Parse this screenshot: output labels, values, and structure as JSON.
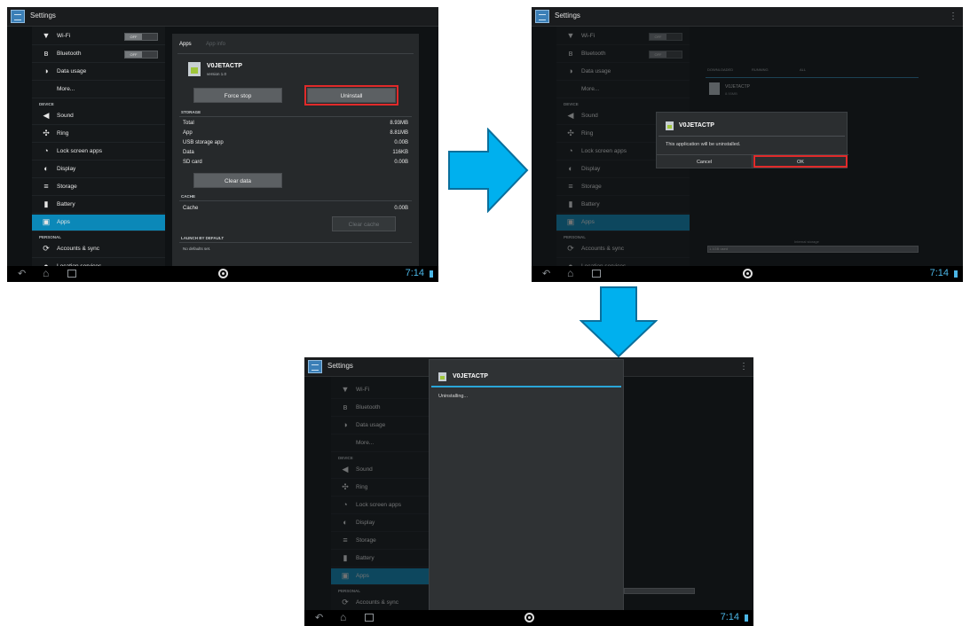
{
  "common": {
    "title": "Settings",
    "clock": "7:14",
    "sidebar": {
      "items": [
        {
          "icon": "▼",
          "label": "Wi-Fi",
          "toggle": "OFF"
        },
        {
          "icon": "ʙ",
          "label": "Bluetooth",
          "toggle": "OFF"
        },
        {
          "icon": "◑",
          "label": "Data usage"
        },
        {
          "icon": "",
          "label": "More..."
        },
        {
          "icon": "◀",
          "label": "Sound"
        },
        {
          "icon": "✣",
          "label": "Ring"
        },
        {
          "icon": "◔",
          "label": "Lock screen apps"
        },
        {
          "icon": "◐",
          "label": "Display"
        },
        {
          "icon": "≡",
          "label": "Storage"
        },
        {
          "icon": "▮",
          "label": "Battery"
        },
        {
          "icon": "▣",
          "label": "Apps"
        },
        {
          "icon": "⟳",
          "label": "Accounts & sync"
        },
        {
          "icon": "●",
          "label": "Location services"
        }
      ],
      "headers": {
        "device": "DEVICE",
        "personal": "PERSONAL"
      }
    }
  },
  "shot1": {
    "crumb": "Apps",
    "crumb_sub": "App info",
    "app_name": "V0JETACTP",
    "app_version": "version 1.0",
    "force_stop": "Force stop",
    "uninstall": "Uninstall",
    "storage_header": "STORAGE",
    "storage_rows": [
      {
        "k": "Total",
        "v": "8.93MB"
      },
      {
        "k": "App",
        "v": "8.81MB"
      },
      {
        "k": "USB storage app",
        "v": "0.00B"
      },
      {
        "k": "Data",
        "v": "116KB"
      },
      {
        "k": "SD card",
        "v": "0.00B"
      }
    ],
    "clear_data": "Clear data",
    "cache_header": "CACHE",
    "cache_row": {
      "k": "Cache",
      "v": "0.00B"
    },
    "clear_cache": "Clear cache",
    "launch_header": "LAUNCH BY DEFAULT",
    "launch_note": "No defaults set."
  },
  "shot2": {
    "tabs": [
      "DOWNLOADED",
      "RUNNING",
      "ALL"
    ],
    "list_app_name": "V0JETACTP",
    "list_app_size": "8.93MB",
    "storage_label": "Internal storage",
    "storage_used": "1.1GB used",
    "storage_free": "1.1GB free",
    "dialog_title": "V0JETACTP",
    "dialog_msg": "This application will be uninstalled.",
    "cancel": "Cancel",
    "ok": "OK"
  },
  "shot3": {
    "dialog_title": "V0JETACTP",
    "dialog_msg": "Uninstalling..."
  },
  "colors": {
    "accent": "#0b88b8",
    "arrow": "#00b0ee",
    "highlight": "#e02a2a"
  }
}
